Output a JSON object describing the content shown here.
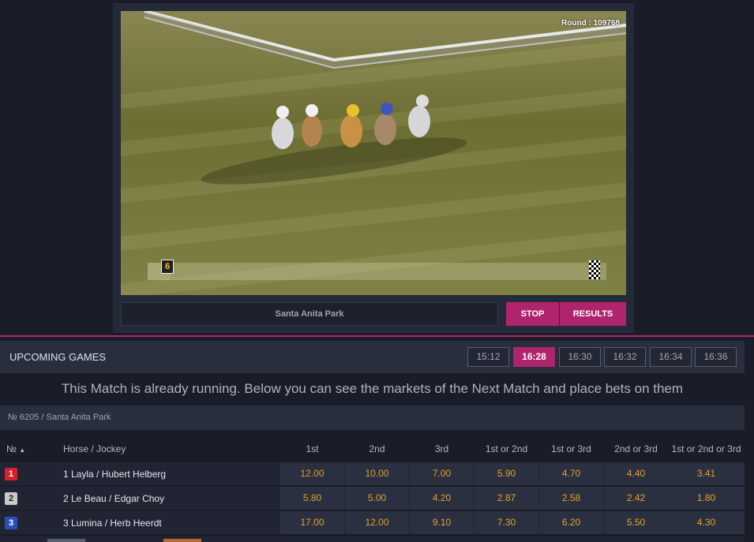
{
  "video": {
    "round_label": "Round : 109768",
    "runner_number": "6",
    "race_progress_percent": 5,
    "venue": "Santa Anita Park",
    "stop_label": "STOP",
    "results_label": "RESULTS"
  },
  "upcoming": {
    "title": "UPCOMING GAMES",
    "times": [
      "15:12",
      "16:28",
      "16:30",
      "16:32",
      "16:34",
      "16:36"
    ],
    "active_time": "16:28"
  },
  "notice": "This Match is already running. Below you can see the markets of the Next Match and place bets on them",
  "match": {
    "label": "№ 6205 / Santa Anita Park"
  },
  "table": {
    "headers": {
      "num": "№",
      "horse": "Horse / Jockey",
      "cols": [
        "1st",
        "2nd",
        "3rd",
        "1st or 2nd",
        "1st or 3rd",
        "2nd or 3rd",
        "1st or 2nd or 3rd"
      ]
    },
    "rows": [
      {
        "num": "1",
        "color": "#d6212f",
        "name": "1 Layla / Hubert Helberg",
        "odds": [
          "12.00",
          "10.00",
          "7.00",
          "5.90",
          "4.70",
          "4.40",
          "3.41"
        ]
      },
      {
        "num": "2",
        "color": "#c9c9c9",
        "name": "2 Le Beau / Edgar Choy",
        "odds": [
          "5.80",
          "5.00",
          "4.20",
          "2.87",
          "2.58",
          "2.42",
          "1.80"
        ]
      },
      {
        "num": "3",
        "color": "#2b4fb8",
        "name": "3 Lumina / Herb Heerdt",
        "odds": [
          "17.00",
          "12.00",
          "9.10",
          "7.30",
          "6.20",
          "5.50",
          "4.30"
        ]
      }
    ]
  },
  "colors": {
    "accent": "#b0246e",
    "odds_text": "#e1a12a"
  }
}
